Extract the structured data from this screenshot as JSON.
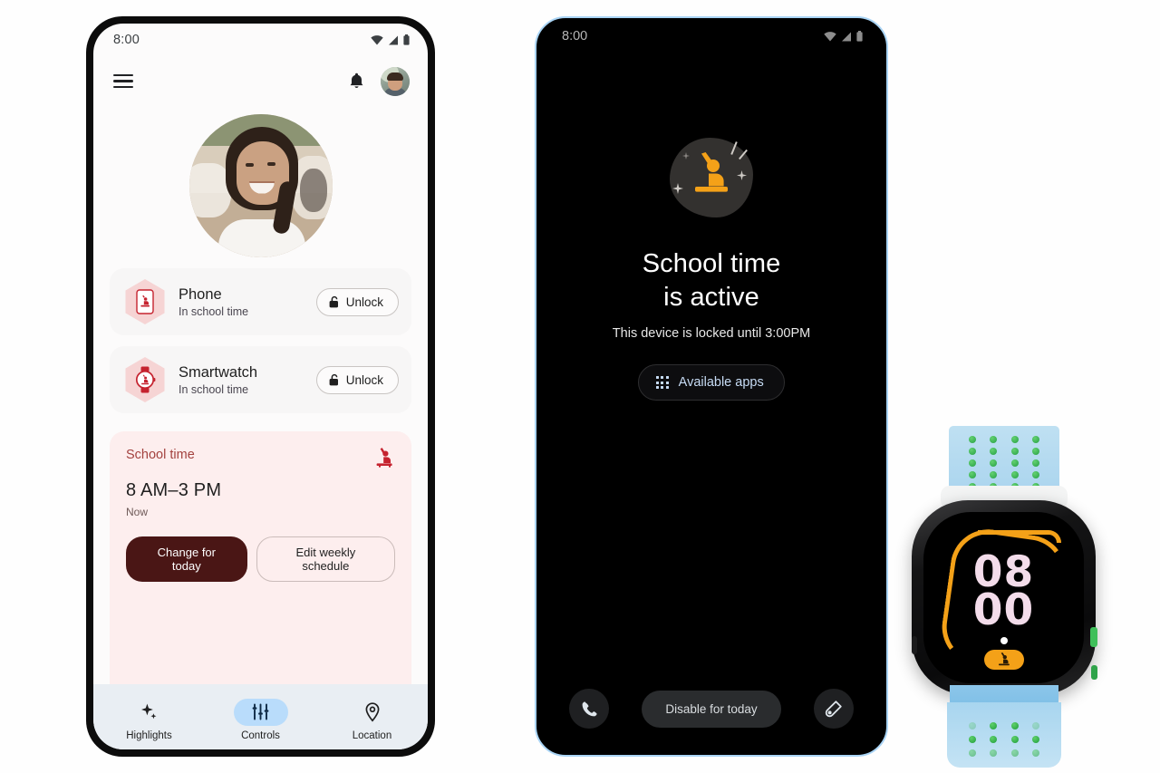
{
  "parent_phone": {
    "status_bar": {
      "time": "8:00",
      "icons": [
        "wifi-icon",
        "signal-icon",
        "battery-icon"
      ]
    },
    "app_bar": {
      "menu_icon": "hamburger-menu-icon",
      "notification_icon": "bell-icon",
      "avatar": "parent-avatar"
    },
    "hero": {
      "photo_alt": "child-profile-photo"
    },
    "devices": [
      {
        "icon": "phone-school-time-icon",
        "name": "Phone",
        "status": "In school time",
        "action_label": "Unlock",
        "action_icon": "unlock-icon"
      },
      {
        "icon": "watch-school-time-icon",
        "name": "Smartwatch",
        "status": "In school time",
        "action_label": "Unlock",
        "action_icon": "unlock-icon"
      }
    ],
    "schedule": {
      "title": "School time",
      "icon": "student-raising-hand-icon",
      "time_range": "8 AM–3 PM",
      "state": "Now",
      "primary_action": "Change for today",
      "secondary_action": "Edit weekly schedule"
    },
    "bottom_nav": [
      {
        "icon": "sparkle-icon",
        "label": "Highlights",
        "active": false
      },
      {
        "icon": "sliders-icon",
        "label": "Controls",
        "active": true
      },
      {
        "icon": "location-pin-icon",
        "label": "Location",
        "active": false
      }
    ]
  },
  "child_phone": {
    "status_bar": {
      "time": "8:00",
      "icons": [
        "wifi-icon",
        "signal-icon",
        "battery-icon"
      ]
    },
    "lock_screen": {
      "icon": "student-raising-hand-icon",
      "headline_line1": "School time",
      "headline_line2": "is active",
      "subtitle": "This device is locked until 3:00PM",
      "apps_button_label": "Available apps",
      "apps_button_icon": "app-grid-icon"
    },
    "bottom_actions": {
      "call_icon": "phone-call-icon",
      "disable_label": "Disable for today",
      "camera_icon": "camera-lens-icon"
    }
  },
  "watch": {
    "face": {
      "hours": "08",
      "minutes": "00",
      "badge_icon": "student-raising-hand-icon"
    },
    "colors": {
      "accent": "#f4a118",
      "digits": "#f3dcea",
      "band": "#a9d4ee",
      "holes": "#1f9e3c"
    }
  },
  "colors": {
    "page_background": "#fefefe",
    "light_screen": "#fcfbfb",
    "card_background": "#f7f6f6",
    "schedule_card": "#fdeeee",
    "schedule_title": "#a3423f",
    "primary_button": "#4a1615",
    "nav_background": "#e9eef3",
    "nav_active_pill": "#b9dcfb",
    "dark_screen": "#000000",
    "dark_border": "#a9d4f5",
    "apps_button_text": "#c7dcf5",
    "hex_badge": "#f6d4d4",
    "device_glyph": "#c5232f"
  }
}
